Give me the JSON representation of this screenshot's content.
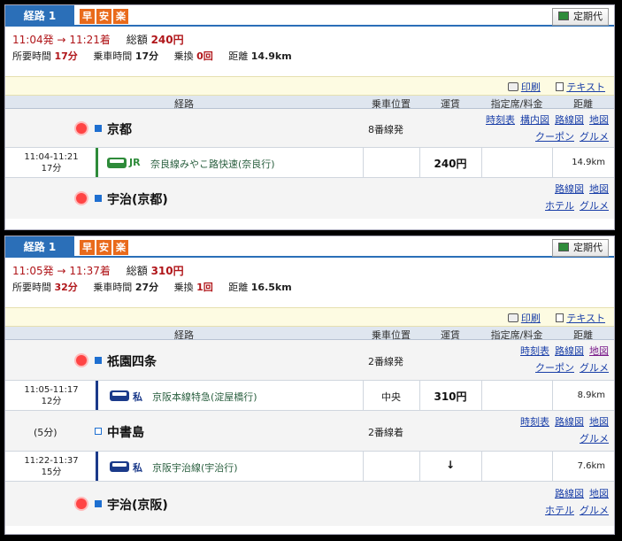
{
  "colors": {
    "accent": "#2b6fb8",
    "badge": "#e96a1b",
    "jr_green": "#2e8b3a",
    "private_blue": "#1b3a8a",
    "price_red": "#b0161a"
  },
  "common": {
    "tab_label": "経路 1",
    "badges": [
      "早",
      "安",
      "楽"
    ],
    "teiki_label": "定期代",
    "print_label": "印刷",
    "text_label": "テキスト",
    "fare_label": "総額",
    "duration_label": "所要時間",
    "ride_label": "乗車時間",
    "transfer_label": "乗換",
    "distance_label": "距離",
    "headers": {
      "route": "経路",
      "position": "乗車位置",
      "fare": "運賃",
      "reserved": "指定席/料金",
      "distance": "距離"
    },
    "links": {
      "timetable": "時刻表",
      "station_map": "構内図",
      "route_map": "路線図",
      "map": "地図",
      "coupon": "クーポン",
      "gourmet": "グルメ",
      "hotel": "ホテル"
    }
  },
  "route1": {
    "depart": "11:04発",
    "arrow": "→",
    "arrive": "11:21着",
    "total_fare": "240円",
    "duration": "17分",
    "ride_time": "17分",
    "transfers": "0回",
    "distance": "14.9km",
    "origin": {
      "name": "京都",
      "platform": "8番線発"
    },
    "segment": {
      "time": "11:04-11:21",
      "mins": "17分",
      "company": "JR",
      "train": "奈良線みやこ路快速(奈良行)",
      "fare": "240円",
      "distance": "14.9km"
    },
    "destination": {
      "name": "宇治(京都)"
    }
  },
  "route2": {
    "depart": "11:05発",
    "arrow": "→",
    "arrive": "11:37着",
    "total_fare": "310円",
    "duration": "32分",
    "ride_time": "27分",
    "transfers": "1回",
    "distance": "16.5km",
    "origin": {
      "name": "祇園四条",
      "platform": "2番線発"
    },
    "segment1": {
      "time": "11:05-11:17",
      "mins": "12分",
      "company": "私",
      "train": "京阪本線特急(淀屋橋行)",
      "position": "中央",
      "fare": "310円",
      "distance": "8.9km"
    },
    "transfer": {
      "wait": "(5分)",
      "name": "中書島",
      "platform": "2番線着"
    },
    "segment2": {
      "time": "11:22-11:37",
      "mins": "15分",
      "company": "私",
      "train": "京阪宇治線(宇治行)",
      "fare_arrow": "↓",
      "distance": "7.6km"
    },
    "destination": {
      "name": "宇治(京阪)"
    }
  }
}
